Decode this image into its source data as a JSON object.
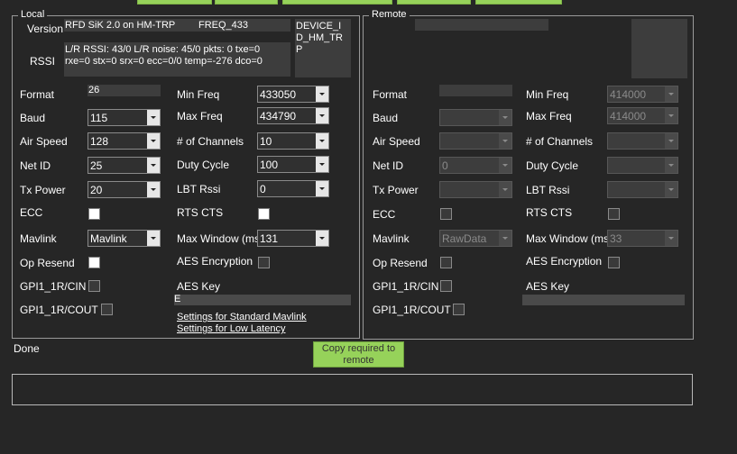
{
  "local": {
    "legend": "Local",
    "version_label": "Version",
    "version_value": "RFD SiK 2.0 on HM-TRP",
    "freq_value": "FREQ_433",
    "device_value": "DEVICE_ID_HM_TRP",
    "rssi_label": "RSSI",
    "rssi_line1": "L/R RSSI: 43/0  L/R noise: 45/0 pkts: 0  txe=0",
    "rssi_line2": "rxe=0 stx=0 srx=0 ecc=0/0 temp=-276 dco=0",
    "format_label": "Format",
    "format_value": "26",
    "baud_label": "Baud",
    "baud_value": "115",
    "airspeed_label": "Air Speed",
    "airspeed_value": "128",
    "netid_label": "Net ID",
    "netid_value": "25",
    "txpower_label": "Tx Power",
    "txpower_value": "20",
    "ecc_label": "ECC",
    "mavlink_label": "Mavlink",
    "mavlink_value": "Mavlink",
    "opresend_label": "Op Resend",
    "gpi_cin_label": "GPI1_1R/CIN",
    "gpi_cout_label": "GPI1_1R/COUT",
    "minfreq_label": "Min Freq",
    "minfreq_value": "433050",
    "maxfreq_label": "Max Freq",
    "maxfreq_value": "434790",
    "channels_label": "# of Channels",
    "channels_value": "10",
    "duty_label": "Duty Cycle",
    "duty_value": "100",
    "lbt_label": "LBT Rssi",
    "lbt_value": "0",
    "rtscts_label": "RTS CTS",
    "maxwindow_label": "Max Window (ms)",
    "maxwindow_value": "131",
    "aes_label": "AES Encryption",
    "aeskey_label": "AES Key",
    "aeskey_value": "E",
    "link_standard": "Settings for Standard Mavlink",
    "link_lowlatency": "Settings for Low Latency"
  },
  "remote": {
    "legend": "Remote",
    "format_label": "Format",
    "baud_label": "Baud",
    "airspeed_label": "Air Speed",
    "netid_label": "Net ID",
    "netid_value": "0",
    "txpower_label": "Tx Power",
    "ecc_label": "ECC",
    "mavlink_label": "Mavlink",
    "mavlink_value": "RawData",
    "opresend_label": "Op Resend",
    "gpi_cin_label": "GPI1_1R/CIN",
    "gpi_cout_label": "GPI1_1R/COUT",
    "minfreq_label": "Min Freq",
    "minfreq_value": "414000",
    "maxfreq_label": "Max Freq",
    "maxfreq_value": "414000",
    "channels_label": "# of Channels",
    "duty_label": "Duty Cycle",
    "lbt_label": "LBT Rssi",
    "rtscts_label": "RTS CTS",
    "maxwindow_label": "Max Window (ms)",
    "maxwindow_value": "33",
    "aes_label": "AES Encryption",
    "aeskey_label": "AES Key"
  },
  "status_text": "Done",
  "copy_button_label": "Copy required to remote",
  "colors": {
    "background": "#262626",
    "accent_button": "#96d25a"
  }
}
